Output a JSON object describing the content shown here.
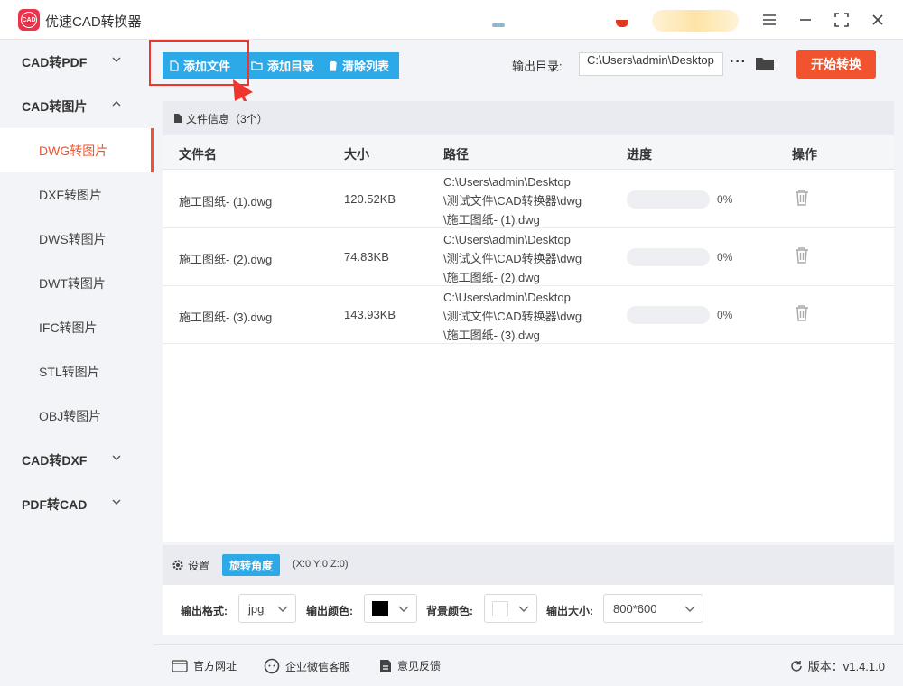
{
  "app": {
    "title": "优速CAD转换器",
    "logo_text": "CAD"
  },
  "window": {
    "menu": "≡",
    "minimize": "—",
    "maximize": "⛶",
    "close": "✕"
  },
  "sidebar": {
    "groups": [
      {
        "label": "CAD转PDF",
        "expanded": false
      },
      {
        "label": "CAD转图片",
        "expanded": true
      },
      {
        "label": "CAD转DXF",
        "expanded": false
      },
      {
        "label": "PDF转CAD",
        "expanded": false
      }
    ],
    "sub_items": [
      "DWG转图片",
      "DXF转图片",
      "DWS转图片",
      "DWT转图片",
      "IFC转图片",
      "STL转图片",
      "OBJ转图片"
    ],
    "active_sub": "DWG转图片"
  },
  "toolbar": {
    "add_file": "添加文件",
    "add_folder": "添加目录",
    "clear_list": "清除列表",
    "output_label": "输出目录:",
    "output_path": "C:\\Users\\admin\\Desktop",
    "more": "···",
    "start": "开始转换"
  },
  "panel": {
    "header": "文件信息（3个）",
    "columns": {
      "name": "文件名",
      "size": "大小",
      "path": "路径",
      "progress": "进度",
      "action": "操作"
    },
    "rows": [
      {
        "name": "施工图纸- (1).dwg",
        "size": "120.52KB",
        "path1": "C:\\Users\\admin\\Desktop",
        "path2": "\\测试文件\\CAD转换器\\dwg",
        "path3": "\\施工图纸- (1).dwg",
        "progress": 0,
        "pct": "0%"
      },
      {
        "name": "施工图纸- (2).dwg",
        "size": "74.83KB",
        "path1": "C:\\Users\\admin\\Desktop",
        "path2": "\\测试文件\\CAD转换器\\dwg",
        "path3": "\\施工图纸- (2).dwg",
        "progress": 0,
        "pct": "0%"
      },
      {
        "name": "施工图纸- (3).dwg",
        "size": "143.93KB",
        "path1": "C:\\Users\\admin\\Desktop",
        "path2": "\\测试文件\\CAD转换器\\dwg",
        "path3": "\\施工图纸- (3).dwg",
        "progress": 0,
        "pct": "0%"
      }
    ]
  },
  "settings": {
    "label": "设置",
    "rotate": "旋转角度",
    "coords": "(X:0 Y:0 Z:0)",
    "format_label": "输出格式:",
    "format": "jpg",
    "color_label": "输出颜色:",
    "color": "#000000",
    "bg_label": "背景颜色:",
    "bg": "#ffffff",
    "size_label": "输出大小:",
    "size": "800*600"
  },
  "footer": {
    "website": "官方网址",
    "wechat": "企业微信客服",
    "feedback": "意见反馈",
    "version": "版本：v1.4.1.0"
  },
  "colors": {
    "accent": "#f0532d",
    "blue": "#2ea9e8",
    "annotation": "#f0352d"
  }
}
